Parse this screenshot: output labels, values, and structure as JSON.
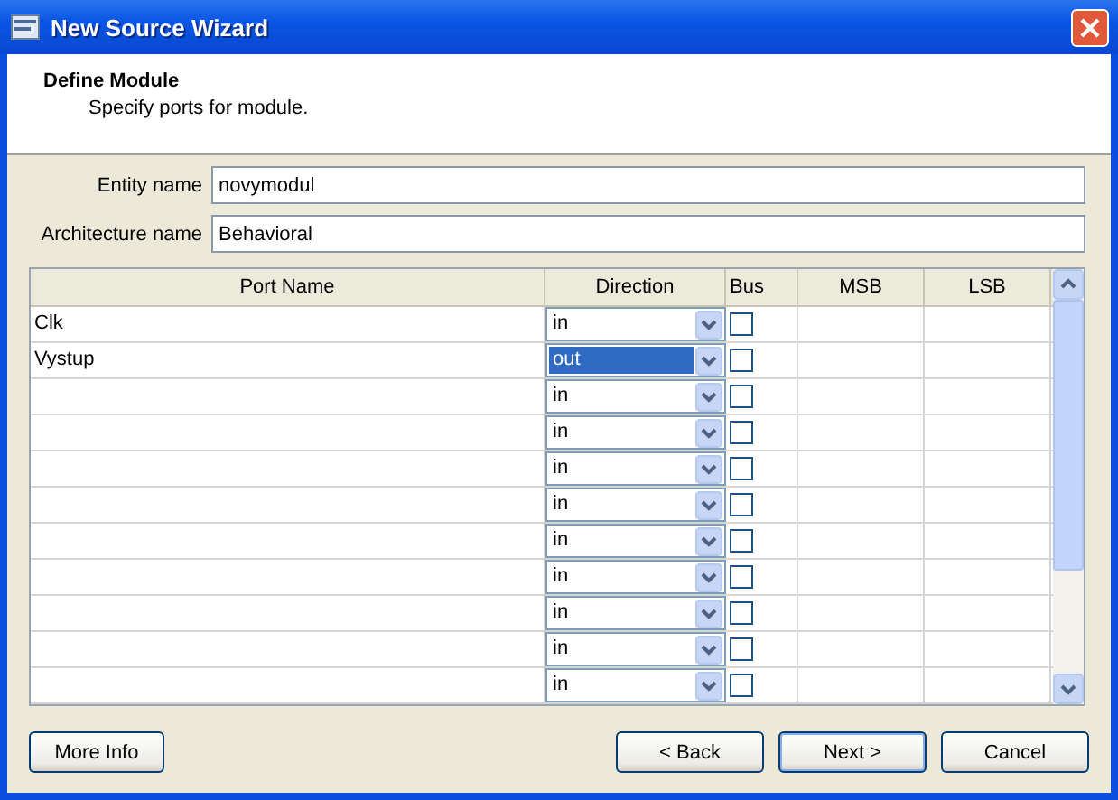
{
  "window": {
    "title": "New Source Wizard"
  },
  "header": {
    "title": "Define Module",
    "subtitle": "Specify ports for module."
  },
  "fields": [
    {
      "label": "Entity name",
      "value": "novymodul"
    },
    {
      "label": "Architecture name",
      "value": "Behavioral"
    }
  ],
  "table": {
    "columns": [
      "Port Name",
      "Direction",
      "Bus",
      "MSB",
      "LSB"
    ],
    "rows": [
      {
        "port_name": "Clk",
        "direction": "in",
        "selected": false,
        "bus": false
      },
      {
        "port_name": "Vystup",
        "direction": "out",
        "selected": true,
        "bus": false
      },
      {
        "port_name": "",
        "direction": "in",
        "selected": false,
        "bus": false
      },
      {
        "port_name": "",
        "direction": "in",
        "selected": false,
        "bus": false
      },
      {
        "port_name": "",
        "direction": "in",
        "selected": false,
        "bus": false
      },
      {
        "port_name": "",
        "direction": "in",
        "selected": false,
        "bus": false
      },
      {
        "port_name": "",
        "direction": "in",
        "selected": false,
        "bus": false
      },
      {
        "port_name": "",
        "direction": "in",
        "selected": false,
        "bus": false
      },
      {
        "port_name": "",
        "direction": "in",
        "selected": false,
        "bus": false
      },
      {
        "port_name": "",
        "direction": "in",
        "selected": false,
        "bus": false
      },
      {
        "port_name": "",
        "direction": "in",
        "selected": false,
        "bus": false
      }
    ]
  },
  "buttons": {
    "left": [
      "More Info"
    ],
    "right": [
      "< Back",
      "Next >",
      "Cancel"
    ]
  }
}
